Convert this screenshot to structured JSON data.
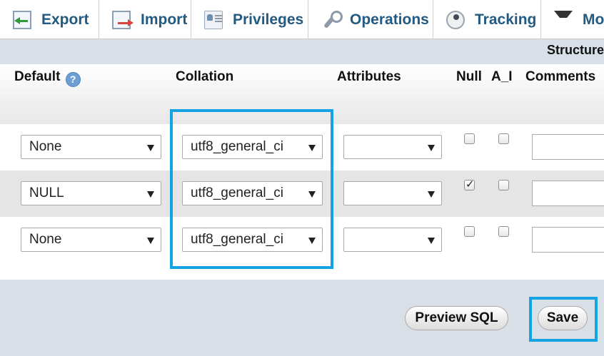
{
  "tabs": [
    {
      "label": "Export",
      "icon": "export-icon"
    },
    {
      "label": "Import",
      "icon": "import-icon"
    },
    {
      "label": "Privileges",
      "icon": "privileges-icon"
    },
    {
      "label": "Operations",
      "icon": "wrench-icon"
    },
    {
      "label": "Tracking",
      "icon": "eye-icon"
    },
    {
      "label": "More",
      "icon": "caret-down-icon"
    }
  ],
  "section_label": "Structure",
  "columns": {
    "default": "Default",
    "collation": "Collation",
    "attributes": "Attributes",
    "null": "Null",
    "ai": "A_I",
    "comments": "Comments"
  },
  "help_glyph": "?",
  "rows": [
    {
      "default": "None",
      "collation": "utf8_general_ci",
      "attributes": "",
      "null_checked": false,
      "ai_checked": false,
      "comment": ""
    },
    {
      "default": "NULL",
      "collation": "utf8_general_ci",
      "attributes": "",
      "null_checked": true,
      "ai_checked": false,
      "comment": ""
    },
    {
      "default": "None",
      "collation": "utf8_general_ci",
      "attributes": "",
      "null_checked": false,
      "ai_checked": false,
      "comment": ""
    }
  ],
  "buttons": {
    "preview_sql": "Preview SQL",
    "save": "Save"
  },
  "colors": {
    "highlight": "#15a3e3",
    "tab_text": "#235a81",
    "background": "#d8dfe6"
  }
}
